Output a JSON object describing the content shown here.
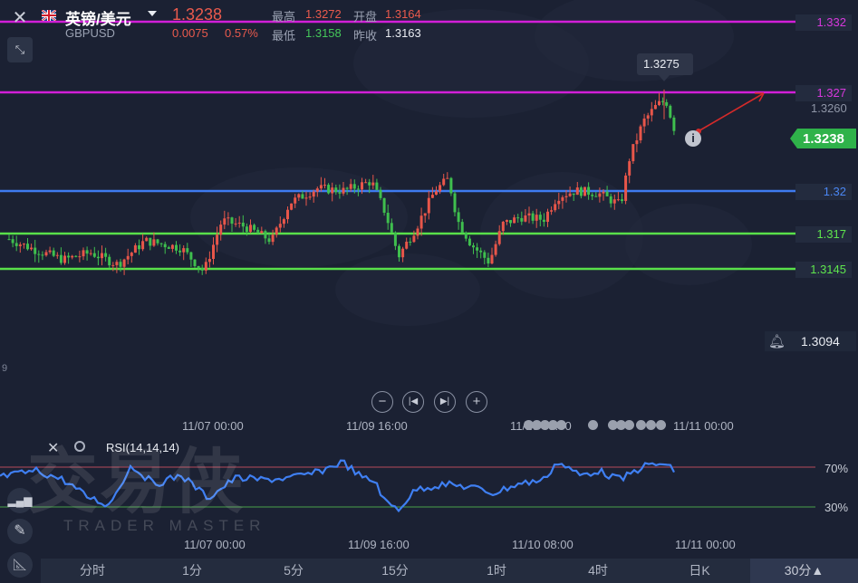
{
  "header": {
    "pair_name": "英镑/美元",
    "symbol": "GBPUSD",
    "last_price": "1.3238",
    "change": "0.0075",
    "change_pct": "0.57%",
    "high_label": "最高",
    "high_value": "1.3272",
    "low_label": "最低",
    "low_value": "1.3158",
    "open_label": "开盘",
    "open_value": "1.3164",
    "prev_close_label": "昨收",
    "prev_close_value": "1.3163"
  },
  "price_levels": [
    {
      "label": "1.332",
      "color": "#d21fd8"
    },
    {
      "label": "1.327",
      "color": "#d21fd8"
    },
    {
      "label": "1.32",
      "color": "#3e7bf0"
    },
    {
      "label": "1.317",
      "color": "#59e04a"
    },
    {
      "label": "1.3145",
      "color": "#59e04a"
    }
  ],
  "axis_prices": {
    "secondary": "1.3260",
    "current": "1.3238",
    "alert": "1.3094",
    "peak_tooltip": "1.3275",
    "partial_left": "9"
  },
  "time_axis_main": [
    "11/07 00:00",
    "11/09 16:00",
    "11/10 08:00",
    "11/11 00:00"
  ],
  "time_axis_rsi": [
    "11/07 00:00",
    "11/09 16:00",
    "11/10 08:00",
    "11/11 00:00"
  ],
  "rsi": {
    "label": "RSI(14,14,14)",
    "level_high": "70%",
    "level_low": "30%",
    "color": "#3f7ff2"
  },
  "watermark": {
    "cn": "交易侠",
    "en": "TRADER MASTER"
  },
  "timeframes": [
    "分时",
    "1分",
    "5分",
    "15分",
    "1时",
    "4时",
    "日K",
    "30分▲"
  ],
  "colors": {
    "up": "#e8564a",
    "down": "#3fbf4e",
    "background": "#1b2133",
    "current_tag": "#2fb24a"
  },
  "icons": {
    "close": "close-icon",
    "shrink": "shrink-icon",
    "dropdown": "chevron-down-icon",
    "bell": "bell-icon",
    "info": "info-icon",
    "zoom_out": "zoom-out-icon",
    "prev": "prev-icon",
    "next": "next-icon",
    "zoom_in": "zoom-in-icon",
    "draw": "pen-icon",
    "ruler": "ruler-icon",
    "indicator": "indicator-icon",
    "settings": "settings-icon"
  }
}
